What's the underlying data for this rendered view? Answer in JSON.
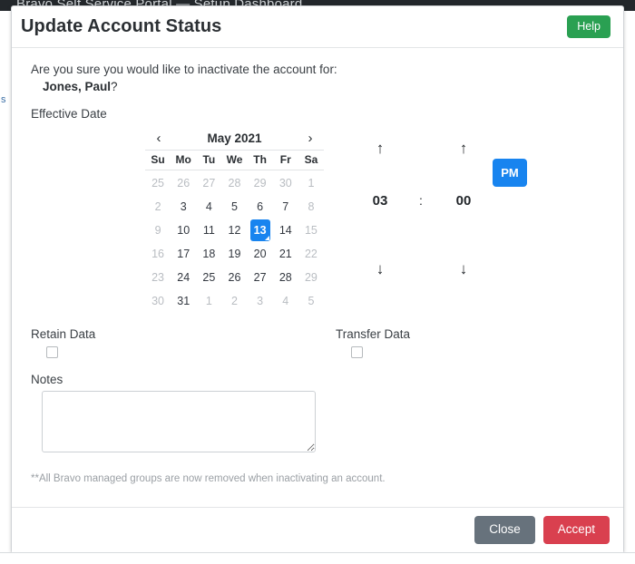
{
  "background": {
    "topbar_text": "Bravo Self Service Portal — Setup Dashboard",
    "side_text": "s"
  },
  "dialog": {
    "title": "Update Account Status",
    "help_label": "Help",
    "confirm_question": "Are you sure you would like to inactivate the account for:",
    "account_name": "Jones, Paul",
    "account_name_suffix": "?",
    "effective_date_label": "Effective Date",
    "footnote": "**All Bravo managed groups are now removed when inactivating an account.",
    "footer": {
      "close_label": "Close",
      "accept_label": "Accept"
    }
  },
  "calendar": {
    "prev_icon": "‹",
    "next_icon": "›",
    "month_label": "May 2021",
    "day_headers": [
      "Su",
      "Mo",
      "Tu",
      "We",
      "Th",
      "Fr",
      "Sa"
    ],
    "selected_day": 13,
    "weeks": [
      [
        {
          "d": "25",
          "state": "muted"
        },
        {
          "d": "26",
          "state": "muted"
        },
        {
          "d": "27",
          "state": "muted"
        },
        {
          "d": "28",
          "state": "muted"
        },
        {
          "d": "29",
          "state": "muted"
        },
        {
          "d": "30",
          "state": "muted"
        },
        {
          "d": "1",
          "state": "weekend"
        }
      ],
      [
        {
          "d": "2",
          "state": "weekend"
        },
        {
          "d": "3",
          "state": "normal"
        },
        {
          "d": "4",
          "state": "normal"
        },
        {
          "d": "5",
          "state": "normal"
        },
        {
          "d": "6",
          "state": "normal"
        },
        {
          "d": "7",
          "state": "normal"
        },
        {
          "d": "8",
          "state": "weekend"
        }
      ],
      [
        {
          "d": "9",
          "state": "weekend"
        },
        {
          "d": "10",
          "state": "normal"
        },
        {
          "d": "11",
          "state": "normal"
        },
        {
          "d": "12",
          "state": "normal"
        },
        {
          "d": "13",
          "state": "selected"
        },
        {
          "d": "14",
          "state": "normal"
        },
        {
          "d": "15",
          "state": "weekend"
        }
      ],
      [
        {
          "d": "16",
          "state": "weekend"
        },
        {
          "d": "17",
          "state": "normal"
        },
        {
          "d": "18",
          "state": "normal"
        },
        {
          "d": "19",
          "state": "normal"
        },
        {
          "d": "20",
          "state": "normal"
        },
        {
          "d": "21",
          "state": "normal"
        },
        {
          "d": "22",
          "state": "weekend"
        }
      ],
      [
        {
          "d": "23",
          "state": "weekend"
        },
        {
          "d": "24",
          "state": "normal"
        },
        {
          "d": "25",
          "state": "normal"
        },
        {
          "d": "26",
          "state": "normal"
        },
        {
          "d": "27",
          "state": "normal"
        },
        {
          "d": "28",
          "state": "normal"
        },
        {
          "d": "29",
          "state": "weekend"
        }
      ],
      [
        {
          "d": "30",
          "state": "weekend"
        },
        {
          "d": "31",
          "state": "normal"
        },
        {
          "d": "1",
          "state": "muted"
        },
        {
          "d": "2",
          "state": "muted"
        },
        {
          "d": "3",
          "state": "muted"
        },
        {
          "d": "4",
          "state": "muted"
        },
        {
          "d": "5",
          "state": "muted"
        }
      ]
    ]
  },
  "time": {
    "hour": "03",
    "separator": ":",
    "minute": "00",
    "meridiem": "PM",
    "up_icon": "↑",
    "down_icon": "↓"
  },
  "options": {
    "retain_label": "Retain Data",
    "retain_checked": false,
    "transfer_label": "Transfer Data",
    "transfer_checked": false
  },
  "notes": {
    "label": "Notes",
    "value": "",
    "placeholder": ""
  },
  "colors": {
    "help_green": "#2aa052",
    "accent_blue": "#1884ef",
    "close_grey": "#67727c",
    "accept_red": "#d9404f"
  }
}
